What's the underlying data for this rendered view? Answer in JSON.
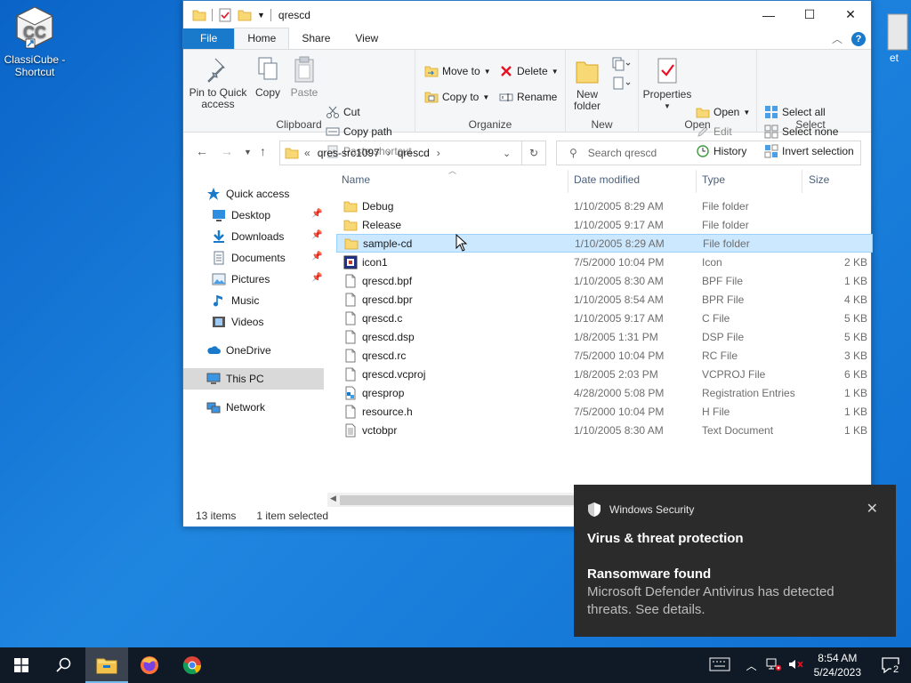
{
  "desktop": {
    "shortcut_label": "ClassiCube - Shortcut",
    "right_fragment": "et"
  },
  "window": {
    "title": "qrescd",
    "tabs": [
      "File",
      "Home",
      "Share",
      "View"
    ]
  },
  "ribbon": {
    "clipboard": {
      "label": "Clipboard",
      "pin": "Pin to Quick access",
      "copy": "Copy",
      "paste": "Paste",
      "cut": "Cut",
      "copy_path": "Copy path",
      "paste_shortcut": "Paste shortcut"
    },
    "organize": {
      "label": "Organize",
      "move_to": "Move to",
      "copy_to": "Copy to",
      "delete": "Delete",
      "rename": "Rename"
    },
    "new": {
      "label": "New",
      "new_folder": "New folder"
    },
    "open": {
      "label": "Open",
      "properties": "Properties",
      "open": "Open",
      "edit": "Edit",
      "history": "History"
    },
    "select": {
      "label": "Select",
      "select_all": "Select all",
      "select_none": "Select none",
      "invert": "Invert selection"
    }
  },
  "address": {
    "prefix": "«",
    "crumb1": "qres-src1097",
    "crumb2": "qrescd",
    "search_placeholder": "Search qrescd"
  },
  "navpane": {
    "quick_access": "Quick access",
    "desktop": "Desktop",
    "downloads": "Downloads",
    "documents": "Documents",
    "pictures": "Pictures",
    "music": "Music",
    "videos": "Videos",
    "onedrive": "OneDrive",
    "this_pc": "This PC",
    "network": "Network"
  },
  "columns": {
    "name": "Name",
    "date": "Date modified",
    "type": "Type",
    "size": "Size"
  },
  "files": [
    {
      "name": "Debug",
      "date": "1/10/2005 8:29 AM",
      "type": "File folder",
      "size": "",
      "icon": "folder"
    },
    {
      "name": "Release",
      "date": "1/10/2005 9:17 AM",
      "type": "File folder",
      "size": "",
      "icon": "folder"
    },
    {
      "name": "sample-cd",
      "date": "1/10/2005 8:29 AM",
      "type": "File folder",
      "size": "",
      "icon": "folder"
    },
    {
      "name": "icon1",
      "date": "7/5/2000 10:04 PM",
      "type": "Icon",
      "size": "2 KB",
      "icon": "icon-file"
    },
    {
      "name": "qrescd.bpf",
      "date": "1/10/2005 8:30 AM",
      "type": "BPF File",
      "size": "1 KB",
      "icon": "file"
    },
    {
      "name": "qrescd.bpr",
      "date": "1/10/2005 8:54 AM",
      "type": "BPR File",
      "size": "4 KB",
      "icon": "file"
    },
    {
      "name": "qrescd.c",
      "date": "1/10/2005 9:17 AM",
      "type": "C File",
      "size": "5 KB",
      "icon": "file"
    },
    {
      "name": "qrescd.dsp",
      "date": "1/8/2005 1:31 PM",
      "type": "DSP File",
      "size": "5 KB",
      "icon": "file"
    },
    {
      "name": "qrescd.rc",
      "date": "7/5/2000 10:04 PM",
      "type": "RC File",
      "size": "3 KB",
      "icon": "file"
    },
    {
      "name": "qrescd.vcproj",
      "date": "1/8/2005 2:03 PM",
      "type": "VCPROJ File",
      "size": "6 KB",
      "icon": "file"
    },
    {
      "name": "qresprop",
      "date": "4/28/2000 5:08 PM",
      "type": "Registration Entries",
      "size": "1 KB",
      "icon": "reg"
    },
    {
      "name": "resource.h",
      "date": "7/5/2000 10:04 PM",
      "type": "H File",
      "size": "1 KB",
      "icon": "file"
    },
    {
      "name": "vctobpr",
      "date": "1/10/2005 8:30 AM",
      "type": "Text Document",
      "size": "1 KB",
      "icon": "text"
    }
  ],
  "selected_index": 2,
  "status": {
    "count": "13 items",
    "selected": "1 item selected"
  },
  "toast": {
    "app": "Windows Security",
    "title": "Virus & threat protection",
    "heading": "Ransomware found",
    "body": "Microsoft Defender Antivirus has detected threats.  See details."
  },
  "taskbar": {
    "time": "8:54 AM",
    "date": "5/24/2023",
    "notifications": "2"
  },
  "colors": {
    "accent": "#1979ca",
    "selection": "#cce8ff",
    "folder": "#f8d775",
    "taskbar": "#101a26",
    "toast": "#2b2b2b",
    "danger": "#e81123"
  }
}
